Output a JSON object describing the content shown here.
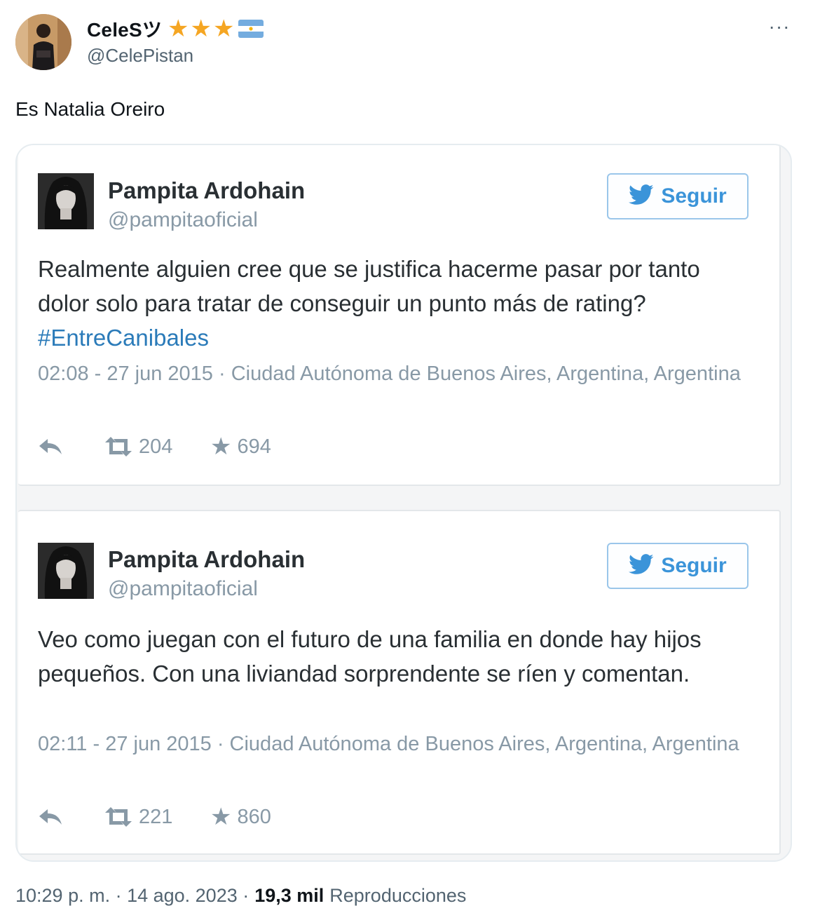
{
  "author": {
    "display_name": "CeleSツ",
    "handle": "@CelePistan",
    "badges": [
      "star",
      "star",
      "star",
      "flag-argentina"
    ],
    "star_color": "#f5a623"
  },
  "more_label": "···",
  "text": "Es Natalia Oreiro",
  "embedded_tweets": [
    {
      "name": "Pampita Ardohain",
      "handle": "@pampitaoficial",
      "follow_label": "Seguir",
      "text": "Realmente alguien cree que se justifica hacerme pasar por tanto dolor solo para tratar de conseguir un punto más de rating?",
      "hashtag": "#EntreCanibales",
      "meta": "02:08 - 27 jun 2015 · Ciudad Autónoma de Buenos Aires, Argentina, Argentina",
      "retweets": "204",
      "favorites": "694"
    },
    {
      "name": "Pampita Ardohain",
      "handle": "@pampitaoficial",
      "follow_label": "Seguir",
      "text": "Veo como juegan con el futuro de una familia en donde hay hijos pequeños. Con una liviandad sorprendente se ríen y comentan.",
      "meta": "02:11 - 27 jun 2015 · Ciudad Autónoma de Buenos Aires, Argentina, Argentina",
      "retweets": "221",
      "favorites": "860"
    }
  ],
  "footer": {
    "timestamp": "10:29 p. m. · 14 ago. 2023 ·",
    "views_count": "19,3 mil",
    "views_label": "Reproducciones"
  },
  "colors": {
    "link": "#2b7bb9",
    "follow": "#3b94d9",
    "muted": "#8899a6"
  }
}
